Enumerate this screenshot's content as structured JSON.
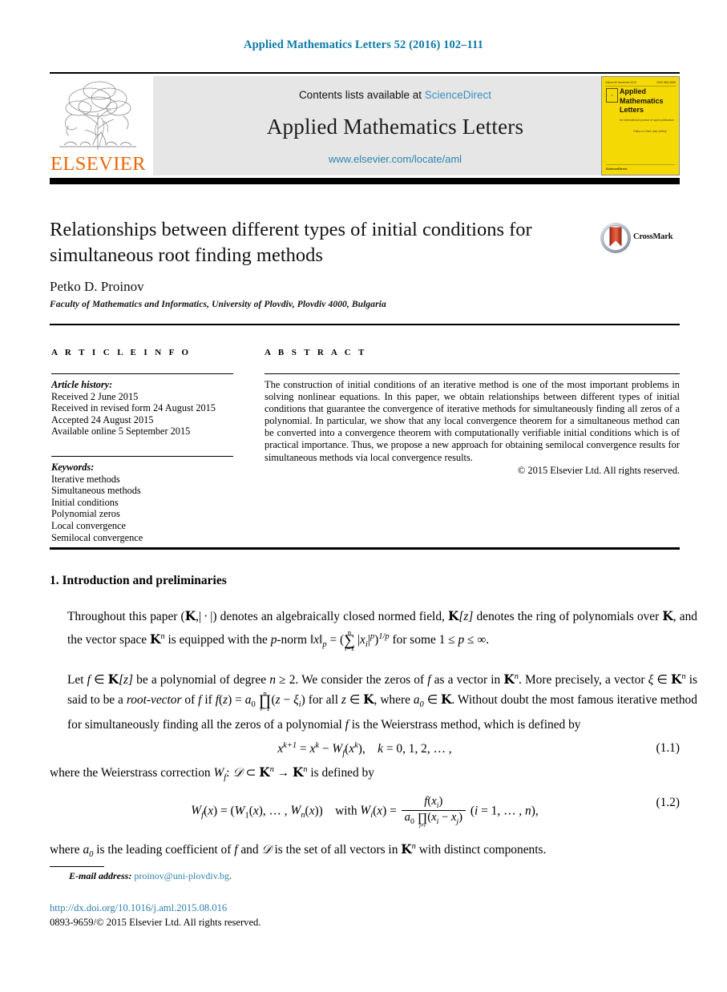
{
  "running_head": "Applied Mathematics Letters 52 (2016) 102–111",
  "masthead": {
    "contents_prefix": "Contents lists available at ",
    "sciencedirect_link": "ScienceDirect",
    "journal_title": "Applied Mathematics Letters",
    "journal_url": "www.elsevier.com/locate/aml",
    "publisher_wordmark": "ELSEVIER",
    "cover": {
      "issn_line": "Volume 52  November 2015",
      "issn_right": "ISSN 0893-9659",
      "title_line_1": "Applied",
      "title_line_2": "Mathematics",
      "title_line_3": "Letters",
      "subtitle": "An international journal of rapid publication",
      "editor_line": "Editor-in-Chief: Alan Jeffrey",
      "footer": "ScienceDirect"
    }
  },
  "title": "Relationships between different types of initial conditions for simultaneous root finding methods",
  "author": "Petko D. Proinov",
  "affiliation": "Faculty of Mathematics and Informatics, University of Plovdiv, Plovdiv 4000, Bulgaria",
  "crossmark_label": "CrossMark",
  "article_info": {
    "heading": "A R T I C L E   I N F O",
    "history_label": "Article history:",
    "history": [
      "Received 2 June 2015",
      "Received in revised form 24 August 2015",
      "Accepted 24 August 2015",
      "Available online 5 September 2015"
    ],
    "keywords_label": "Keywords:",
    "keywords": [
      "Iterative methods",
      "Simultaneous methods",
      "Initial conditions",
      "Polynomial zeros",
      "Local convergence",
      "Semilocal convergence"
    ]
  },
  "abstract": {
    "heading": "A B S T R A C T",
    "text": "The construction of initial conditions of an iterative method is one of the most important problems in solving nonlinear equations. In this paper, we obtain relationships between different types of initial conditions that guarantee the convergence of iterative methods for simultaneously finding all zeros of a polynomial. In particular, we show that any local convergence theorem for a simultaneous method can be converted into a convergence theorem with computationally verifiable initial conditions which is of practical importance. Thus, we propose a new approach for obtaining semilocal convergence results for simultaneous methods via local convergence results.",
    "copyright": "© 2015 Elsevier Ltd. All rights reserved."
  },
  "body": {
    "section_heading": "1. Introduction and preliminaries",
    "paragraph_1_part_1": "Throughout this paper (",
    "paragraph_1_part_2": ") denotes an algebraically closed normed field, ",
    "paragraph_1_part_3": " denotes the ring of polynomials over ",
    "paragraph_1_part_4": ", and the vector space ",
    "paragraph_1_part_5": " is equipped with the ",
    "paragraph_1_part_6": "-norm ",
    "paragraph_1_part_7": " for some ",
    "paragraph_2_part_1": "Let ",
    "paragraph_2_part_2": " be a polynomial of degree ",
    "paragraph_2_part_3": ". We consider the zeros of ",
    "paragraph_2_part_4": " as a vector in ",
    "paragraph_2_part_5": ". More precisely, a vector ",
    "paragraph_2_part_6": " is said to be a ",
    "paragraph_2_rootvector": "root-vector",
    "paragraph_2_part_7": " of ",
    "paragraph_2_part_8": " if ",
    "paragraph_2_part_9": " for all ",
    "paragraph_2_part_10": ", where ",
    "paragraph_2_part_11": ". Without doubt the most famous iterative method for simultaneously finding all the zeros of a polynomial ",
    "paragraph_2_part_12": " is the Weierstrass method, which is defined by",
    "eq_1_number": "(1.1)",
    "lead_in_1_a": "where the Weierstrass correction ",
    "lead_in_1_b": " is defined by",
    "eq_2_number": "(1.2)",
    "paragraph_3_a": "where ",
    "paragraph_3_b": " is the leading coefficient of ",
    "paragraph_3_c": " and ",
    "paragraph_3_d": " is the set of all vectors in ",
    "paragraph_3_e": " with distinct components."
  },
  "footer": {
    "email_label": "E-mail address:",
    "email": "proinov@uni-plovdiv.bg",
    "email_period": ".",
    "doi": "http://dx.doi.org/10.1016/j.aml.2015.08.016",
    "issn_line": "0893-9659/© 2015 Elsevier Ltd. All rights reserved."
  },
  "colors": {
    "link_blue": "#2f7fae",
    "running_head_blue": "#0b7aa8",
    "elsevier_orange": "#eb6608",
    "cover_yellow": "#f5d905",
    "masthead_gray": "#e6e6e6",
    "crossmark_red": "#c0392b"
  }
}
